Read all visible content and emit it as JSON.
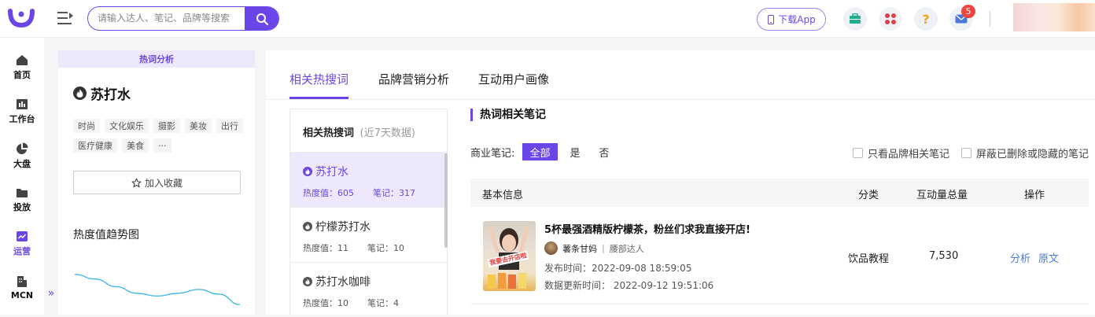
{
  "header": {
    "search_placeholder": "请输入达人、笔记、品牌等搜索",
    "download_label": "下载App",
    "notification_count": "5"
  },
  "sidebar": {
    "items": [
      {
        "label": "首页",
        "icon": "home-icon"
      },
      {
        "label": "工作台",
        "icon": "workbench-icon"
      },
      {
        "label": "大盘",
        "icon": "pie-chart-icon"
      },
      {
        "label": "投放",
        "icon": "folder-icon"
      },
      {
        "label": "运营",
        "icon": "operations-chart-icon",
        "active": true
      },
      {
        "label": "MCN",
        "icon": "building-icon"
      }
    ]
  },
  "left_panel": {
    "header": "热词分析",
    "keyword": "苏打水",
    "tags": [
      "时尚",
      "文化娱乐",
      "摄影",
      "美妆",
      "出行",
      "医疗健康",
      "美食",
      "···"
    ],
    "collect_label": "加入收藏",
    "trend_title": "热度值趋势图"
  },
  "main": {
    "tabs": [
      {
        "label": "相关热搜词",
        "active": true
      },
      {
        "label": "品牌营销分析",
        "active": false
      },
      {
        "label": "互动用户画像",
        "active": false
      }
    ],
    "keyword_list": {
      "title": "相关热搜词",
      "subtitle": "(近7天数据)",
      "items": [
        {
          "name": "苏打水",
          "heat": "热度值：605",
          "notes": "笔记：317",
          "active": true
        },
        {
          "name": "柠檬苏打水",
          "heat": "热度值：11",
          "notes": "笔记：10",
          "active": false
        },
        {
          "name": "苏打水咖啡",
          "heat": "热度值：10",
          "notes": "笔记：4",
          "active": false
        }
      ]
    },
    "notes": {
      "title": "热词相关笔记",
      "filter_label": "商业笔记:",
      "filter_options": [
        "全部",
        "是",
        "否"
      ],
      "checkbox_brand": "只看品牌相关笔记",
      "checkbox_hide": "屏蔽已删除或隐藏的笔记",
      "columns": [
        "基本信息",
        "分类",
        "互动量总量",
        "操作"
      ],
      "rows": [
        {
          "title": "5杯最强酒精版柠檬茶，粉丝们求我直接开店!",
          "author": "薯条甘妈",
          "author_level": "腰部达人",
          "publish_time": "发布时间：2022-09-08 18:59:05",
          "update_time": "数据更新时间：  2022-09-12 19:51:06",
          "category": "饮品教程",
          "interactions": "7,530",
          "actions": [
            "分析",
            "原文"
          ],
          "thumb_caption": "我要去开店啦"
        }
      ]
    }
  },
  "colors": {
    "accent": "#6b45e8",
    "accent_light": "#eee8fc",
    "link": "#4a7ad8",
    "badge": "#f0453e",
    "trend_line": "#38b6e6"
  },
  "trend_series": [
    0.82,
    0.72,
    0.56,
    0.42,
    0.36,
    0.42,
    0.5,
    0.4,
    0.18
  ]
}
